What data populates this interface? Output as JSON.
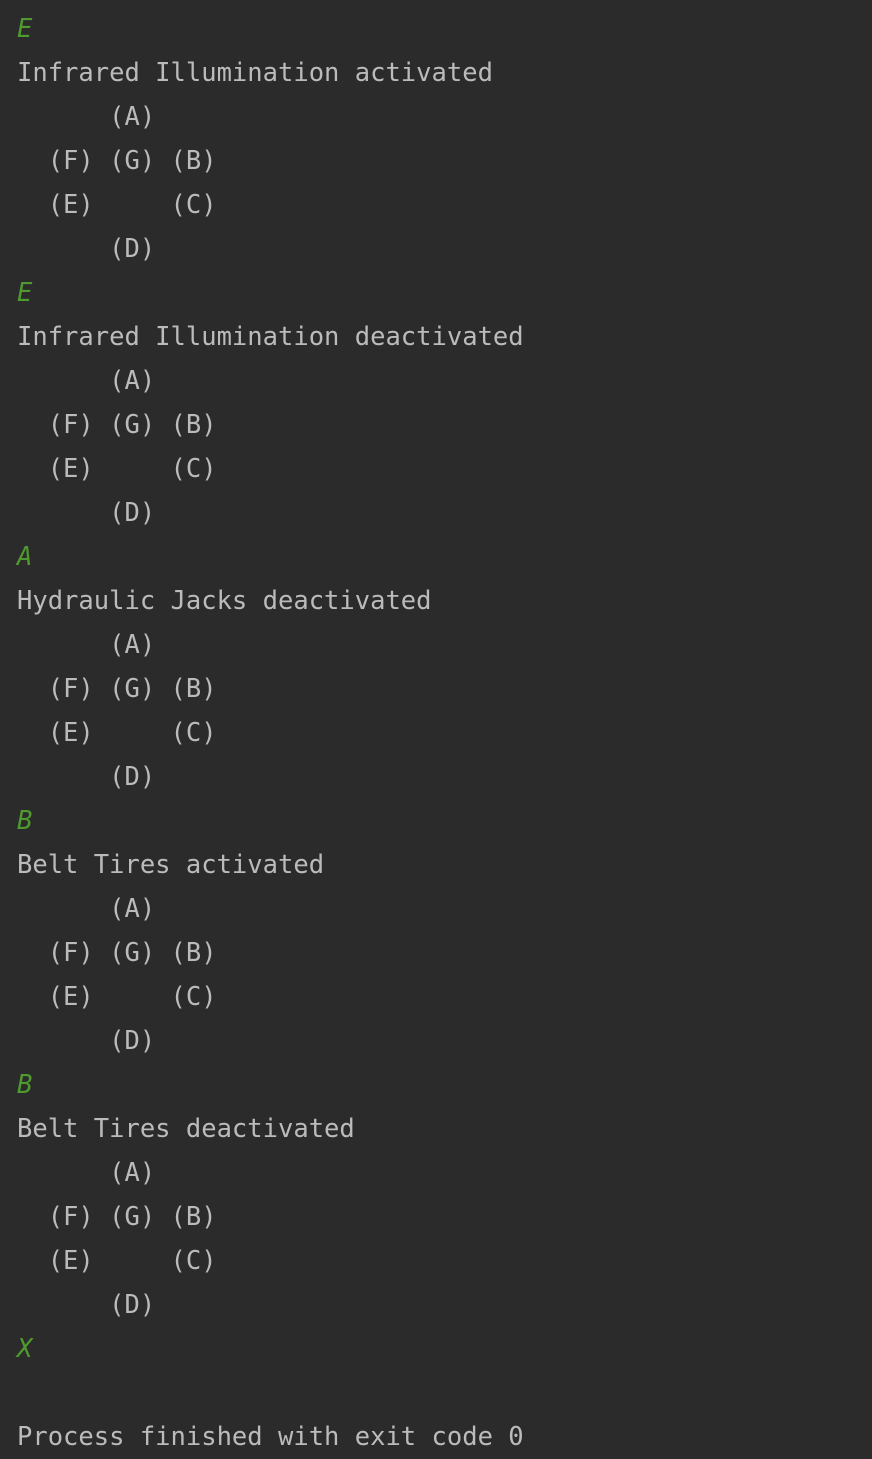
{
  "colors": {
    "background": "#2b2b2b",
    "output_text": "#bbbbbb",
    "user_input": "#4e9a2e"
  },
  "console": {
    "blocks": [
      {
        "input": "E",
        "message": "Infrared Illumination activated",
        "grid": [
          "      (A)",
          "  (F) (G) (B)",
          "  (E)     (C)",
          "      (D)"
        ]
      },
      {
        "input": "E",
        "message": "Infrared Illumination deactivated",
        "grid": [
          "      (A)",
          "  (F) (G) (B)",
          "  (E)     (C)",
          "      (D)"
        ]
      },
      {
        "input": "A",
        "message": "Hydraulic Jacks deactivated",
        "grid": [
          "      (A)",
          "  (F) (G) (B)",
          "  (E)     (C)",
          "      (D)"
        ]
      },
      {
        "input": "B",
        "message": "Belt Tires activated",
        "grid": [
          "      (A)",
          "  (F) (G) (B)",
          "  (E)     (C)",
          "      (D)"
        ]
      },
      {
        "input": "B",
        "message": "Belt Tires deactivated",
        "grid": [
          "      (A)",
          "  (F) (G) (B)",
          "  (E)     (C)",
          "      (D)"
        ]
      }
    ],
    "final_input": "X",
    "exit_message": "Process finished with exit code 0"
  }
}
